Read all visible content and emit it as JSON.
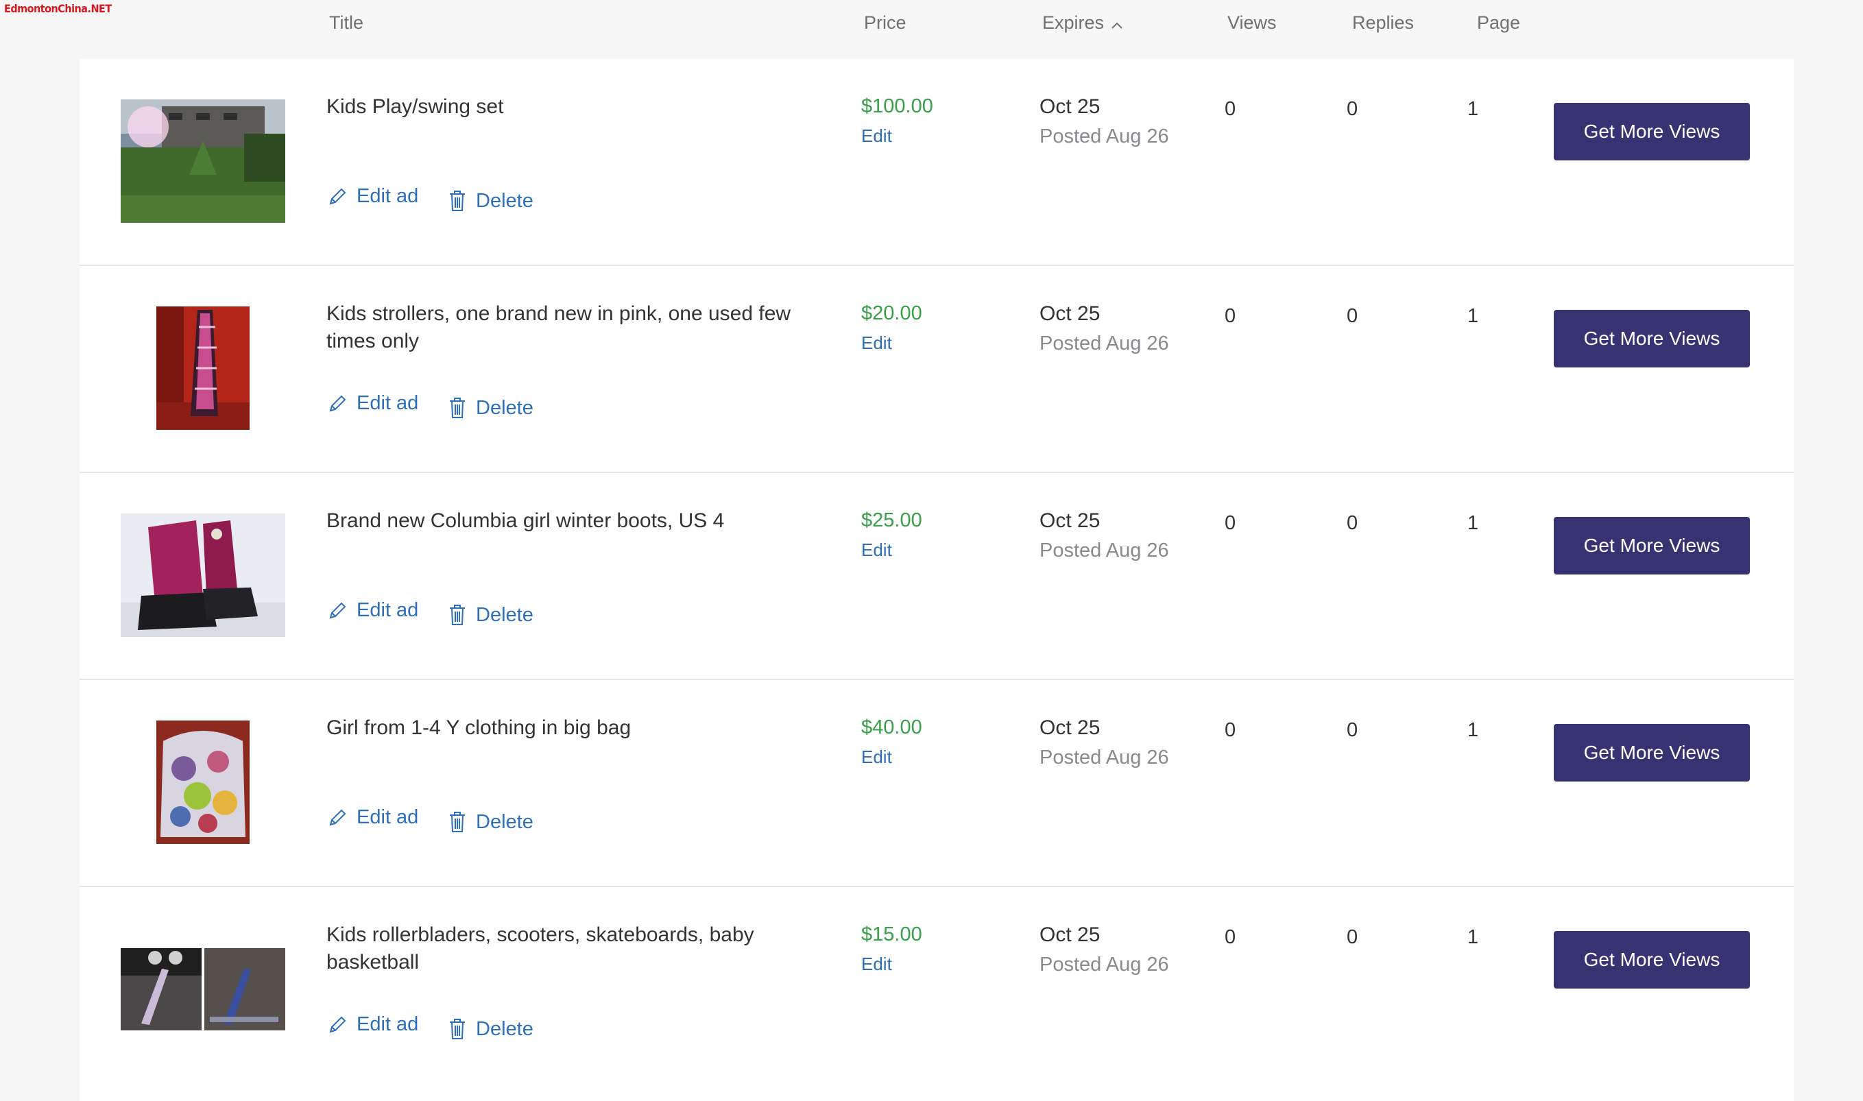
{
  "watermark": "EdmontonChina.NET",
  "columns": {
    "title": "Title",
    "price": "Price",
    "expires": "Expires",
    "views": "Views",
    "replies": "Replies",
    "page": "Page"
  },
  "labels": {
    "edit_ad": "Edit ad",
    "delete": "Delete",
    "price_edit": "Edit",
    "cta": "Get More Views"
  },
  "colors": {
    "price": "#37a048",
    "link": "#2d6fb8",
    "cta_bg": "#373373"
  },
  "icons": [
    "chevron-up-icon",
    "pencil-icon",
    "trash-icon"
  ],
  "ads": [
    {
      "title": "Kids Play/swing set",
      "price": "$100.00",
      "expires": "Oct 25",
      "posted": "Posted Aug 26",
      "views": "0",
      "replies": "0",
      "page": "1",
      "image": "backyard swing set photo"
    },
    {
      "title": "Kids strollers, one brand new in pink, one used few times only",
      "price": "$20.00",
      "expires": "Oct 25",
      "posted": "Posted Aug 26",
      "views": "0",
      "replies": "0",
      "page": "1",
      "image": "pink stroller photo"
    },
    {
      "title": "Brand new Columbia girl winter boots, US 4",
      "price": "$25.00",
      "expires": "Oct 25",
      "posted": "Posted Aug 26",
      "views": "0",
      "replies": "0",
      "page": "1",
      "image": "pink winter boots photo"
    },
    {
      "title": "Girl from 1-4 Y clothing in big bag",
      "price": "$40.00",
      "expires": "Oct 25",
      "posted": "Posted Aug 26",
      "views": "0",
      "replies": "0",
      "page": "1",
      "image": "bag of clothing photo"
    },
    {
      "title": "Kids rollerbladers, scooters, skateboards, baby basketball",
      "price": "$15.00",
      "expires": "Oct 25",
      "posted": "Posted Aug 26",
      "views": "0",
      "replies": "0",
      "page": "1",
      "image": "scooters photo"
    }
  ]
}
